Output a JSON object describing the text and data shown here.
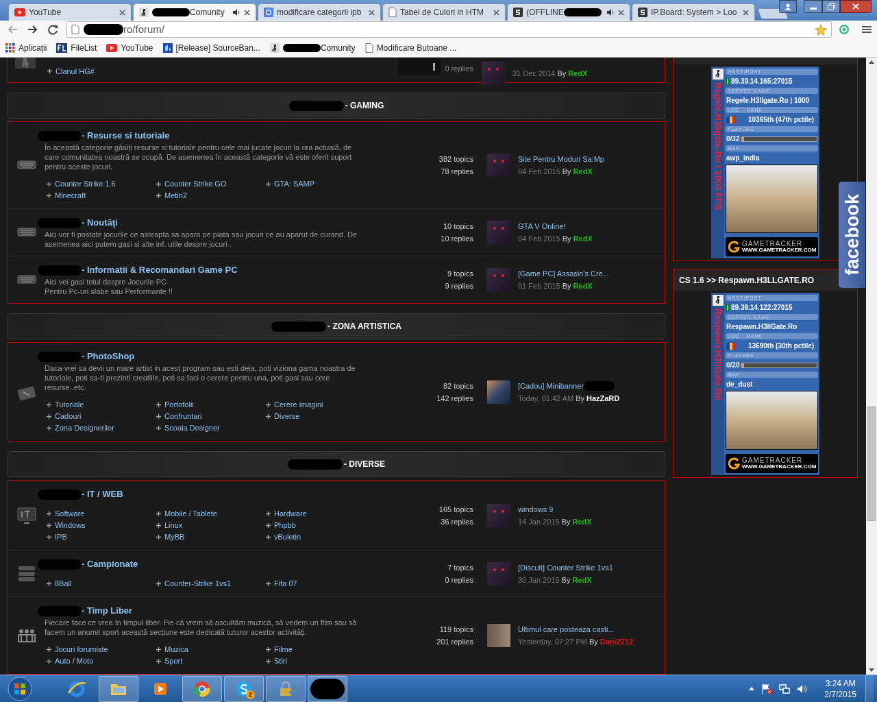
{
  "browser": {
    "tabs": [
      {
        "title": "YouTube",
        "kind": "youtube",
        "redacted_before": false,
        "redacted_after": false,
        "audio": false,
        "selected": false
      },
      {
        "title": "Comunity",
        "kind": "cs",
        "redacted_before": true,
        "redacted_after": false,
        "audio": true,
        "selected": true
      },
      {
        "title": "modificare categorii ipb",
        "kind": "google",
        "redacted_before": false,
        "redacted_after": false,
        "audio": false,
        "selected": false
      },
      {
        "title": "Tabel de Culori in HTM",
        "kind": "doc",
        "redacted_before": false,
        "redacted_after": false,
        "audio": false,
        "selected": false
      },
      {
        "title": "(OFFLINE",
        "kind": "s",
        "redacted_before": false,
        "redacted_after": true,
        "audio": true,
        "selected": false
      },
      {
        "title": "IP.Board: System > Loo",
        "kind": "s",
        "redacted_before": false,
        "redacted_after": false,
        "audio": false,
        "selected": false
      }
    ],
    "address": {
      "url": "ro/forum/",
      "redacted": true
    },
    "bookmarks": [
      {
        "label": "Aplicații",
        "kind": "apps",
        "redacted": false
      },
      {
        "label": "FileList",
        "kind": "filelist",
        "redacted": false
      },
      {
        "label": "YouTube",
        "kind": "youtube",
        "redacted": false
      },
      {
        "label": "[Release] SourceBan...",
        "kind": "sourceban",
        "redacted": false
      },
      {
        "label": "Comunity",
        "kind": "cs",
        "redacted": true
      },
      {
        "label": "Modificare Butoane ...",
        "kind": "doc",
        "redacted": false
      }
    ]
  },
  "forum": {
    "partial_row": {
      "subforums": [
        "Clanul HG#"
      ],
      "replies": "0 replies",
      "last_post": {
        "date": "31 Dec 2014",
        "by": "By",
        "author": "RedX",
        "color": "#1fb51f",
        "kind": "dark"
      }
    },
    "categories": [
      {
        "title": "- GAMING",
        "forums": [
          {
            "kind": "keyboard",
            "title": "- Resurse si tutoriale",
            "description": "În această categorie găsiţi resurse si tutoriale pentru cele mai jucate jocuri la ora actuală, de care comunitatea noastră se ocupă. De asemenea în această categorie vă este oferit suport pentru aceste jocuri.",
            "subforums": [
              "Counter Strike 1.6",
              "Counter Strike GO",
              "GTA: SAMP",
              "Minecraft",
              "Metin2"
            ],
            "topics": "382 topics",
            "replies": "78 replies",
            "last_post": {
              "title": "Site Pentru Moduri Sa:Mp",
              "date": "04 Feb 2015",
              "by": "By",
              "author": "RedX",
              "color": "#1fb51f",
              "kind": "dark"
            }
          },
          {
            "kind": "keyboard",
            "title": "- Noutăţi",
            "description": "Aici vor fi postate jocurile ce asteapta sa apara pe piata sau jocuri ce au aparut de curand. De asemenea aici putem gasi si alte inf. utile despre jocuri .",
            "topics": "10 topics",
            "replies": "10 replies",
            "last_post": {
              "title": "GTA V Online!",
              "date": "04 Feb 2015",
              "by": "By",
              "author": "RedX",
              "color": "#1fb51f",
              "kind": "dark"
            }
          },
          {
            "kind": "keyboard",
            "title": "- Informatii & Recomandari Game PC",
            "description": "Aici vei gasi totul despre Jocurile PC\nPentru Pc-uri slabe sau Performante !!",
            "topics": "9 topics",
            "replies": "9 replies",
            "last_post": {
              "title": "[Game PC] Assasin's Cre...",
              "date": "01 Feb 2015",
              "by": "By",
              "author": "RedX",
              "color": "#1fb51f",
              "kind": "dark"
            }
          }
        ]
      },
      {
        "title": "- ZONA ARTISTICA",
        "forums": [
          {
            "kind": "tablet",
            "title": "- PhotoShop",
            "description": "Daca vrei sa devii un mare artist in acest program sau esti deja, poti viziona gama noastra de tutoriale, poti sa-ti prezinti creatiile, poti sa faci o cerere pentru una, poti gasi sau cere resurse..etc.",
            "subforums": [
              "Tutoriale",
              "Portofolii",
              "Cerere imagini",
              "Cadouri",
              "Confruntari",
              "Diverse",
              "Zona Designerilor",
              "Scoala Designer"
            ],
            "topics": "82 topics",
            "replies": "142 replies",
            "last_post": {
              "title": "[Cadou] Minibanner",
              "title_redacted": true,
              "date": "Today, 01:42 AM",
              "by": "By",
              "author": "HazZaRD",
              "color": "#ffffff",
              "kind": "sky"
            }
          }
        ]
      },
      {
        "title": "- DIVERSE",
        "forums": [
          {
            "kind": "it",
            "title": "- IT / WEB",
            "subforums": [
              "Software",
              "Mobile / Tablete",
              "Hardware",
              "Windows",
              "Linux",
              "Phpbb",
              "IPB",
              "MyBB",
              "vBuletin"
            ],
            "topics": "165 topics",
            "replies": "36 replies",
            "last_post": {
              "title": "windows 9",
              "date": "14 Jan 2015",
              "by": "By",
              "author": "RedX",
              "color": "#1fb51f",
              "kind": "dark"
            }
          },
          {
            "kind": "server",
            "title": "- Campionate",
            "subforums": [
              "8Ball",
              "Counter-Strike 1vs1",
              "Fifa 07"
            ],
            "topics": "7 topics",
            "replies": "0 replies",
            "last_post": {
              "title": "[Discuti] Counter Strike 1vs1",
              "date": "30 Jan 2015",
              "by": "By",
              "author": "RedX",
              "color": "#1fb51f",
              "kind": "dark"
            }
          },
          {
            "kind": "people",
            "title": "- Timp Liber",
            "description": "Fiecare face ce vrea în timpul liber. Fie că vrem să ascultăm muzică, să vedem un film sau să facem un anumit sport această secţiune este dedicată tuturor acestor activităţi.",
            "subforums": [
              "Jocuri forumiste",
              "Muzica",
              "Filme",
              "Auto / Moto",
              "Sport",
              "Stiri"
            ],
            "topics": "119 topics",
            "replies": "201 replies",
            "last_post": {
              "title": "Ultimul care posteaza casti...",
              "date": "Yesterday, 07:27 PM",
              "by": "By",
              "author": "Dani2712",
              "color": "#ee1111",
              "kind": "photo"
            }
          }
        ]
      }
    ]
  },
  "sidebar": {
    "servers": [
      {
        "side_label": "Regele.H3llgate.Ro I 1000 FPS",
        "labels": {
          "host": "HOST/PORT",
          "name": "SERVER NAME",
          "loc": "LOC",
          "rank": "RANK",
          "players": "PLAYERS",
          "map": "MAP"
        },
        "host": "89.39.14.165:27015",
        "name": "Regele.H3llgate.Ro | 1000",
        "rank": "10365th (47th pctile)",
        "players": "0/32",
        "level": 0.02,
        "map": "awp_india",
        "logo": "GAMETRACKER",
        "logo_url": "WWW.GAMETRACKER.COM"
      },
      {
        "header": "CS 1.6 >> Respawn.H3LLGATE.RO",
        "side_label": "Respawn.H3llGate.Ro",
        "labels": {
          "host": "HOST/PORT",
          "name": "SERVER NAME",
          "loc": "LOC",
          "rank": "RANK",
          "players": "PLAYERS",
          "map": "MAP"
        },
        "host": "89.39.14.122:27015",
        "name": "Respawn.H3llGate.Ro",
        "rank": "13690th (30th pctile)",
        "players": "0/20",
        "level": 0.02,
        "map": "de_dust",
        "logo": "GAMETRACKER",
        "logo_url": "WWW.GAMETRACKER.COM"
      }
    ],
    "facebook": "facebook"
  },
  "taskbar": {
    "apps": [
      {
        "kind": "ie",
        "running": false
      },
      {
        "kind": "explorer",
        "running": true
      },
      {
        "kind": "media",
        "running": false
      },
      {
        "kind": "chrome",
        "running": true
      },
      {
        "kind": "skype",
        "running": true,
        "badge": "2"
      },
      {
        "kind": "lock",
        "running": true
      },
      {
        "kind": "redacted",
        "running": true
      }
    ],
    "time": "3:24 AM",
    "date": "2/7/2015"
  }
}
